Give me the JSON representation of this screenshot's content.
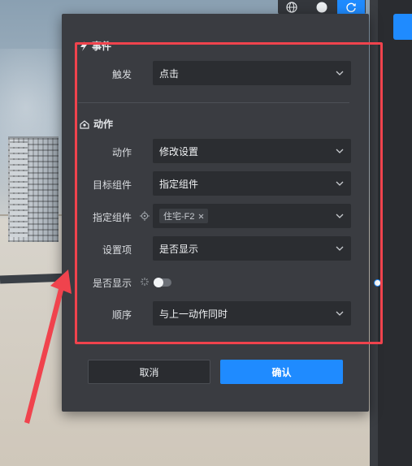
{
  "toolbar": {
    "buttons": [
      {
        "icon": "globe-icon",
        "active": false
      },
      {
        "icon": "sphere-icon",
        "active": false
      },
      {
        "icon": "refresh-icon",
        "active": true
      }
    ]
  },
  "modal": {
    "event_section": {
      "title": "事件",
      "trigger_label": "触发",
      "trigger_value": "点击"
    },
    "action_section": {
      "title": "动作",
      "action_label": "动作",
      "action_value": "修改设置",
      "target_label": "目标组件",
      "target_value": "指定组件",
      "specified_label": "指定组件",
      "specified_tag": "住宅-F2",
      "setting_label": "设置项",
      "setting_value": "是否显示",
      "visible_label": "是否显示",
      "visible_on": false,
      "order_label": "顺序",
      "order_value": "与上一动作同时"
    },
    "cancel_label": "取消",
    "confirm_label": "确认"
  },
  "colors": {
    "accent": "#1f8bff",
    "annotation": "#f0434d",
    "panel": "#3a3c41",
    "field": "#2b2d31"
  }
}
